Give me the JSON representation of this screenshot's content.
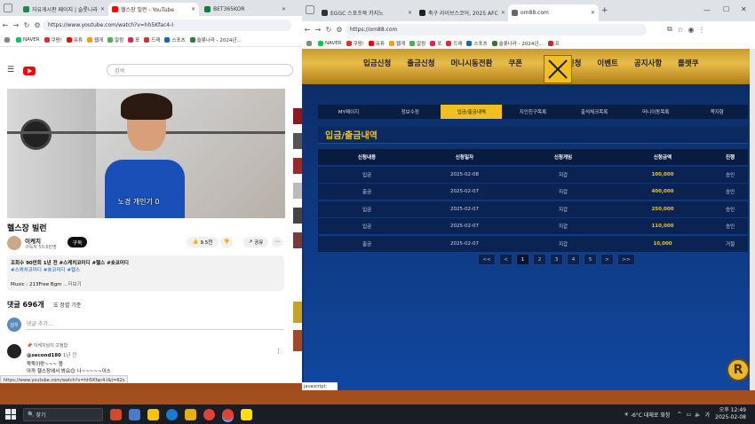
{
  "left_browser": {
    "tabs": [
      {
        "label": "자유게시판 페이지 | 슬롯나라"
      },
      {
        "label": "헬스장 빌런 - YouTube"
      },
      {
        "label": "BET365KOR"
      }
    ],
    "url": "https://www.youtube.com/watch?v=hh5Kfac4-I",
    "bookmarks": [
      "NAVER",
      "쿠팡!",
      "유튜",
      "웹게",
      "알람",
      "포",
      "드래",
      "스포츠",
      "슬롯나라 - 2024년...",
      "프"
    ],
    "search_placeholder": "검색",
    "video_caption": "노경 개인기 0",
    "video_title": "헬스장 빌런",
    "channel_name": "이케치",
    "subscribers": "구독자 50.6만명",
    "subscribe_label": "구독",
    "likes": "9.5천",
    "share_label": "공유",
    "desc_stats": "조회수 90만회 1년 전 #스케치코미디 #헬스 #숏코미디",
    "desc_tags": "#스케치코미디 #숏코미디 #헬스",
    "desc_music": "Music : 213Free Bgm",
    "desc_more": "...더보기",
    "comments_count": "댓글 696개",
    "sort_label": "정렬 기준",
    "comment_placeholder": "댓글 추가...",
    "my_avatar": "김우",
    "pinned_label": "이케치님이 고정함",
    "comment_user": "@second180",
    "comment_time": "1년 전",
    "comment_line1": "뚝뚝이랑~~~ 뭉",
    "comment_line2": "아까 헬스장에서 봐요😊 나~~~~~이스",
    "status_url": "https://www.youtube.com/watch?v=hh5Kfac4-l&t=62s"
  },
  "right_browser": {
    "tabs": [
      {
        "label": "EGGC 스포츠북 카지노"
      },
      {
        "label": "축구 라이브스코어, 2025 AFC"
      },
      {
        "label": "om88.com"
      }
    ],
    "url": "https://om88.com",
    "bookmarks": [
      "NAVER",
      "쿠팡!",
      "유튜",
      "웹게",
      "알람",
      "포",
      "드래",
      "스포츠",
      "슬롯나라 - 2024년...",
      "프"
    ],
    "main_nav": [
      "입금신청",
      "출금신청",
      "머니시동전환",
      "쿠폰",
      "콤프신청",
      "이벤트",
      "공지사항",
      "롤렛쿠"
    ],
    "sub_nav": [
      "MY페이지",
      "정보수정",
      "입금/출금내역",
      "지인친구목록",
      "출석체크목록",
      "머니이동목록",
      "쪽지함"
    ],
    "sub_nav_active": 2,
    "panel_title": "입금/출금내역",
    "columns": [
      "신청내용",
      "신청일자",
      "신청게임",
      "신청금액",
      "진행"
    ],
    "rows": [
      {
        "type": "입금",
        "date": "2025-02-08",
        "game": "지갑",
        "amount": "100,000",
        "status": "승인"
      },
      {
        "type": "출금",
        "date": "2025-02-07",
        "game": "지갑",
        "amount": "400,000",
        "status": "승인"
      },
      {
        "type": "입금",
        "date": "2025-02-07",
        "game": "지갑",
        "amount": "250,000",
        "status": "승인"
      },
      {
        "type": "입금",
        "date": "2025-02-07",
        "game": "지갑",
        "amount": "110,000",
        "status": "승인"
      },
      {
        "type": "출금",
        "date": "2025-02-07",
        "game": "지갑",
        "amount": "10,000",
        "status": "거절"
      }
    ],
    "pager": [
      "<<",
      "<",
      "1",
      "2",
      "3",
      "4",
      "5",
      ">",
      ">>"
    ],
    "pager_active": "1",
    "status_text": "javascript:"
  },
  "taskbar": {
    "search_label": "찾기",
    "weather": "-6°C 대체로 화창",
    "time": "오후 12:49",
    "date": "2025-02-08"
  },
  "colors": {
    "accent_gold": "#f0c020",
    "panel_blue": "#0f3470",
    "youtube_red": "#ff0000"
  }
}
